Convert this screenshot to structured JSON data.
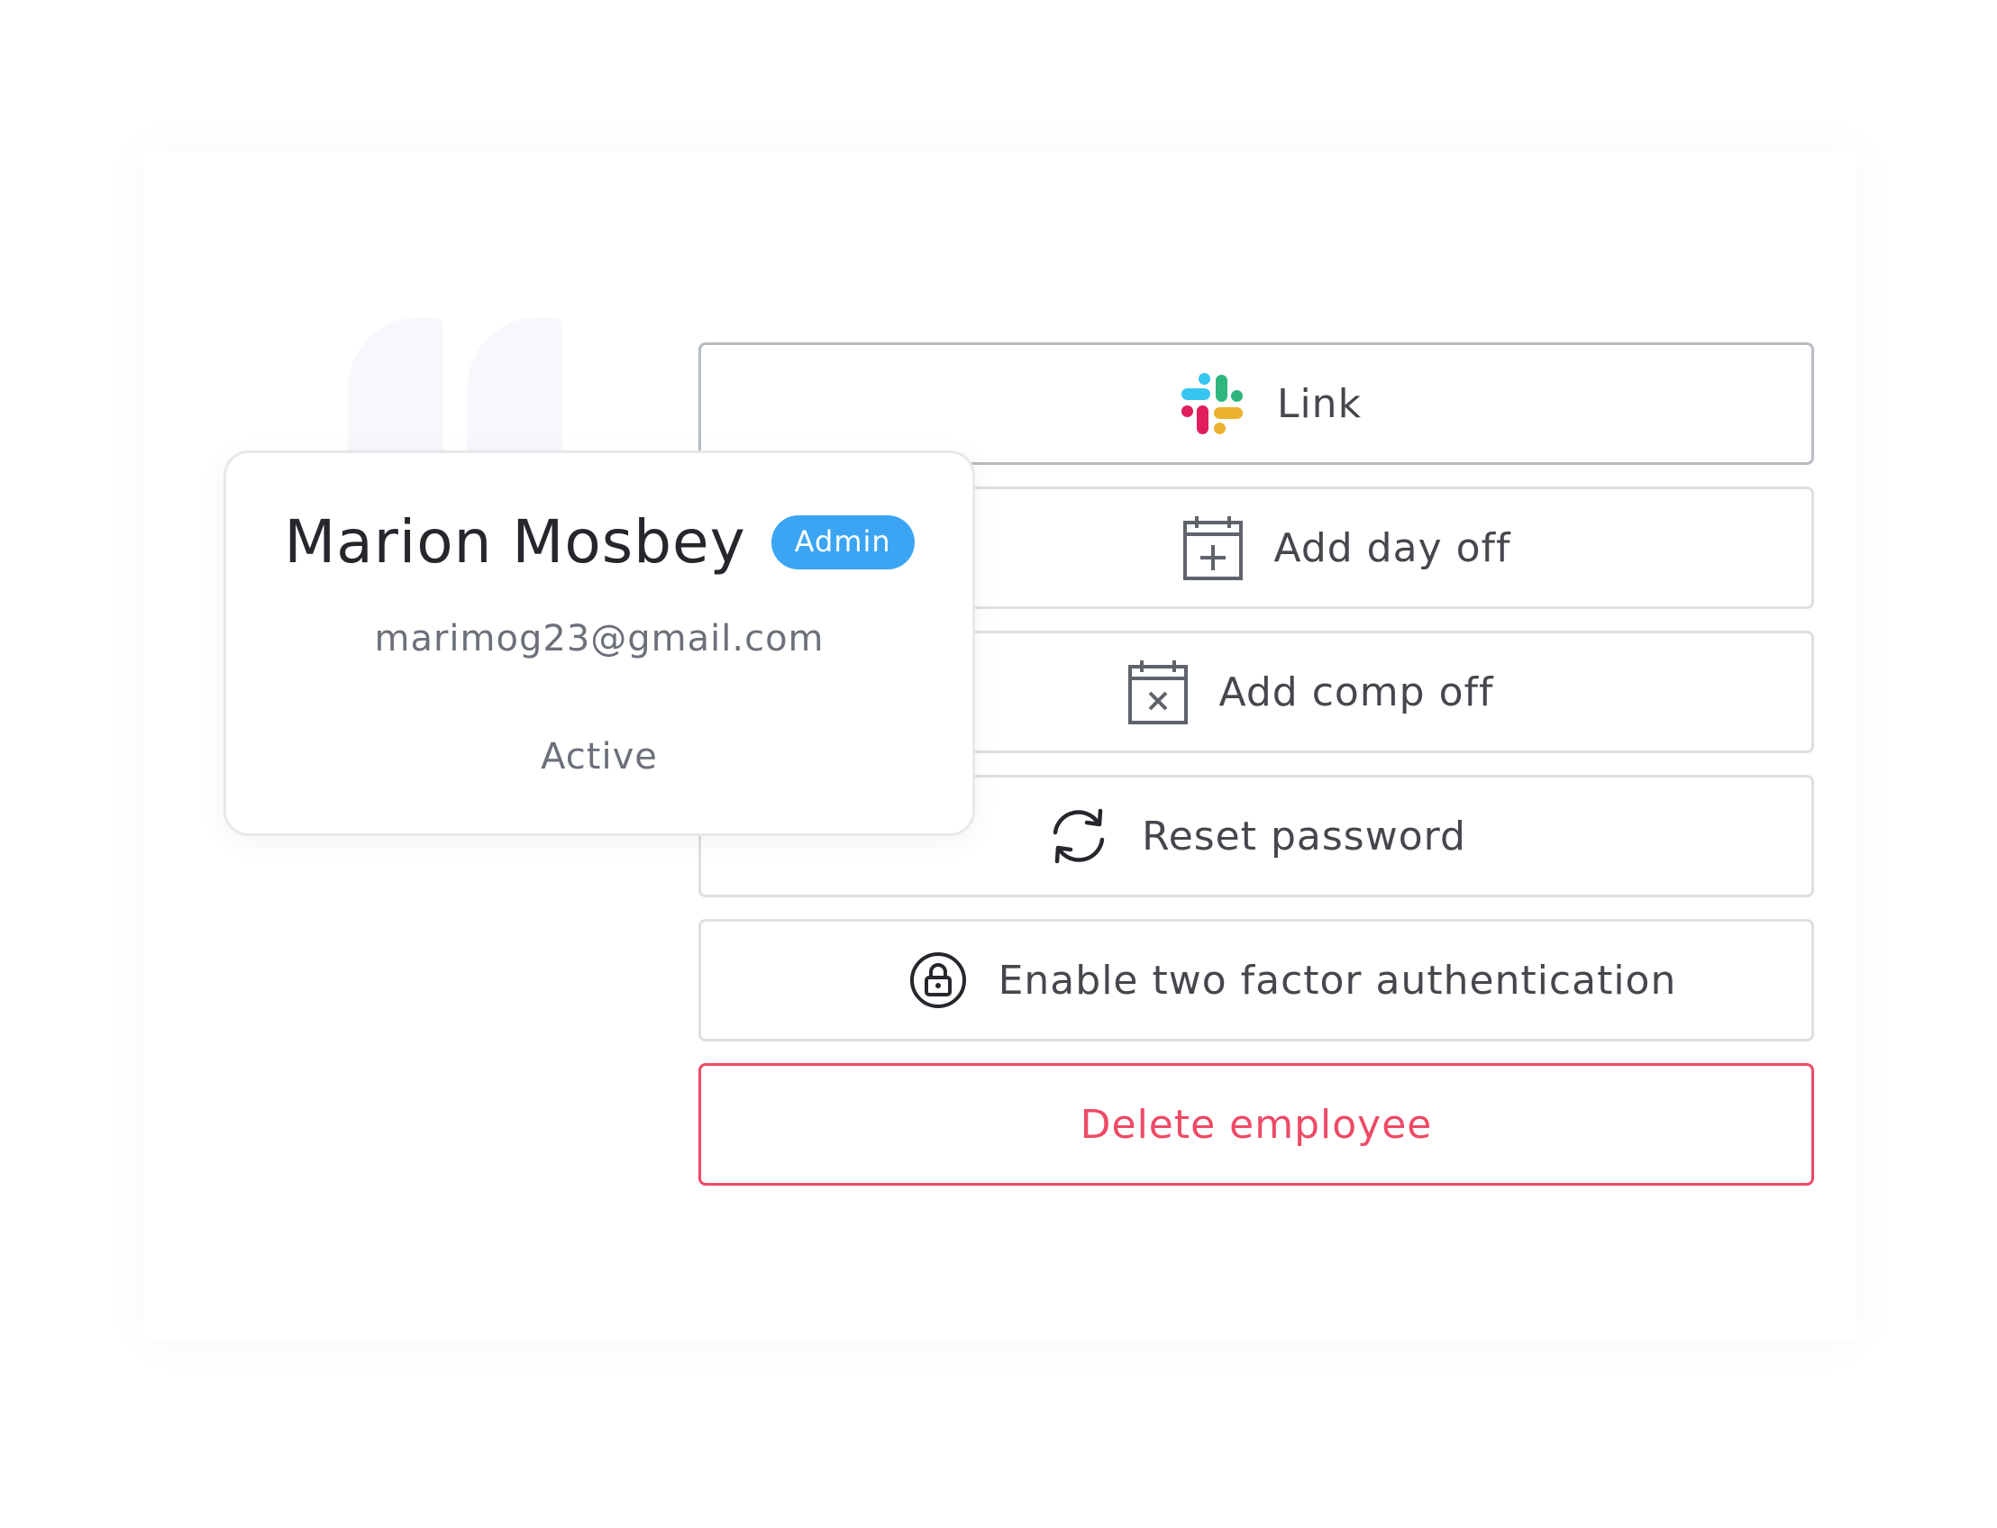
{
  "profile": {
    "name": "Marion Mosbey",
    "role_badge": "Admin",
    "email": "marimog23@gmail.com",
    "status": "Active"
  },
  "actions": [
    {
      "label": "Link",
      "icon": "slack-icon"
    },
    {
      "label": "Add day off",
      "icon": "calendar-plus-icon"
    },
    {
      "label": "Add comp off",
      "icon": "calendar-x-icon"
    },
    {
      "label": "Reset password",
      "icon": "refresh-icon"
    },
    {
      "label": "Enable two factor authentication",
      "icon": "lock-icon"
    },
    {
      "label": "Delete employee",
      "icon": ""
    }
  ],
  "colors": {
    "badge": "#3ba5f3",
    "danger": "#ee4a66",
    "text": "#45474d",
    "slack_blue": "#36c5f0",
    "slack_green": "#2eb67d",
    "slack_red": "#e01e5a",
    "slack_yellow": "#ecb22e"
  }
}
